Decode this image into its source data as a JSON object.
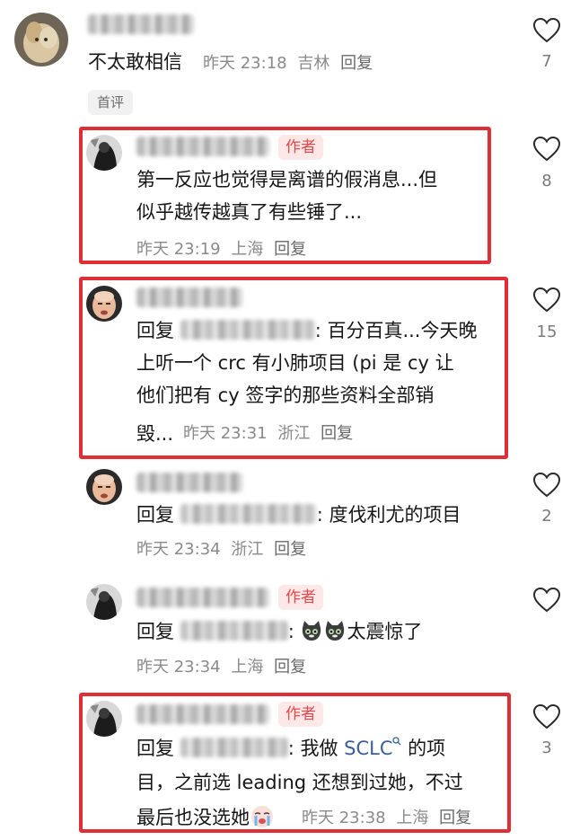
{
  "top_comment": {
    "text": "不太敢相信",
    "time": "昨天 23:18",
    "location": "吉林",
    "reply_label": "回复",
    "likes": "7",
    "badge": "首评"
  },
  "replies": [
    {
      "author_tag": "作者",
      "text": "第一反应也觉得是离谱的假消息...但似乎越传越真了有些锤了...",
      "line1": "第一反应也觉得是离谱的假消息...但",
      "line2": "似乎越传越真了有些锤了...",
      "time": "昨天 23:19",
      "location": "上海",
      "reply_label": "回复",
      "likes": "8"
    },
    {
      "prefix": "回复",
      "line1_suffix": ": 百分百真...今天晚",
      "line2": "上听一个 crc 有小肺项目 (pi 是 cy 让",
      "line3": "他们把有 cy 签字的那些资料全部销",
      "line4_start": "毁...",
      "time": "昨天 23:31",
      "location": "浙江",
      "reply_label": "回复",
      "likes": "15"
    },
    {
      "prefix": "回复",
      "suffix": ": 度伐利尤的项目",
      "time": "昨天 23:34",
      "location": "浙江",
      "reply_label": "回复",
      "likes": "2"
    },
    {
      "author_tag": "作者",
      "prefix": "回复",
      "suffix": "太震惊了",
      "time": "昨天 23:34",
      "location": "上海",
      "reply_label": "回复",
      "likes": ""
    },
    {
      "author_tag": "作者",
      "prefix": "回复",
      "line1_mid": ": 我做 ",
      "link": "SCLC",
      "line1_end": " 的项",
      "line2": "目，之前选 leading 还想到过她，不过",
      "line3": "最后也没选她",
      "time": "昨天 23:38",
      "location": "上海",
      "reply_label": "回复",
      "likes": "3"
    }
  ],
  "colors": {
    "highlight_border": "#e02e36",
    "author_tag_text": "#e8474a",
    "author_tag_bg": "#fde8e8",
    "meta_text": "#8a8a8a"
  },
  "icons": {
    "like": "heart-outline-icon",
    "search_hint": "search-icon",
    "cat_emoji": "cat-emoji-icon",
    "crying_emoji": "crying-emoji-icon"
  }
}
